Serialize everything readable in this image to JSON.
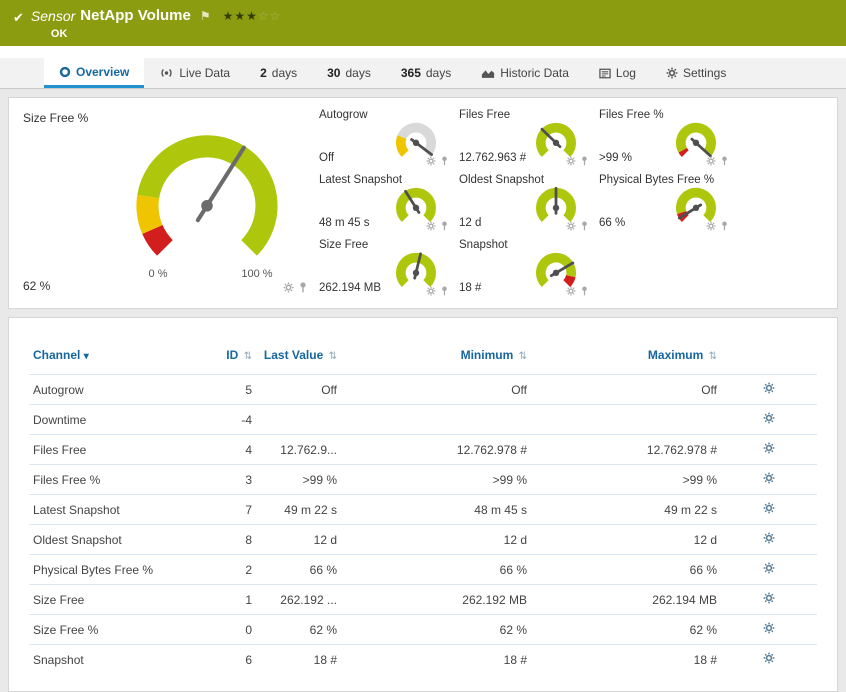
{
  "header": {
    "kind": "Sensor",
    "title": "NetApp Volume",
    "status": "OK",
    "stars_filled": 3,
    "stars_total": 5
  },
  "tabs": [
    {
      "label": "Overview",
      "icon": "overview-icon",
      "active": true
    },
    {
      "label": "Live Data",
      "icon": "live-data-icon",
      "active": false
    },
    {
      "bold": "2",
      "label": "days",
      "active": false
    },
    {
      "bold": "30",
      "label": "days",
      "active": false
    },
    {
      "bold": "365",
      "label": "days",
      "active": false
    },
    {
      "label": "Historic Data",
      "icon": "historic-data-icon",
      "active": false
    },
    {
      "label": "Log",
      "icon": "log-icon",
      "active": false
    },
    {
      "label": "Settings",
      "icon": "settings-icon",
      "active": false
    }
  ],
  "primary_gauge": {
    "label": "Size Free %",
    "value": "62 %",
    "min_label": "0 %",
    "max_label": "100 %",
    "needle": 0.62,
    "segments": [
      {
        "from": 0,
        "to": 0.08,
        "color": "#d21e1c"
      },
      {
        "from": 0.08,
        "to": 0.2,
        "color": "#eec500"
      },
      {
        "from": 0.2,
        "to": 1,
        "color": "#aec70c"
      }
    ]
  },
  "mini_gauges": [
    {
      "label": "Autogrow",
      "value": "Off",
      "needle": 0.97,
      "segments": [
        {
          "from": 0,
          "to": 0.25,
          "color": "#eec500"
        },
        {
          "from": 0.25,
          "to": 1,
          "color": "#d9d9d9"
        }
      ]
    },
    {
      "label": "Files Free",
      "value": "12.762.963 #",
      "needle": 0.33,
      "segments": [
        {
          "from": 0,
          "to": 1,
          "color": "#aec70c"
        }
      ]
    },
    {
      "label": "Files Free %",
      "value": ">99 %",
      "needle": 0.99,
      "segments": [
        {
          "from": 0,
          "to": 0.06,
          "color": "#d21e1c"
        },
        {
          "from": 0.06,
          "to": 1,
          "color": "#aec70c"
        }
      ]
    },
    {
      "label": "Latest Snapshot",
      "value": "48 m 45 s",
      "needle": 0.38,
      "segments": [
        {
          "from": 0,
          "to": 1,
          "color": "#aec70c"
        }
      ]
    },
    {
      "label": "Oldest Snapshot",
      "value": "12 d",
      "needle": 0.5,
      "segments": [
        {
          "from": 0,
          "to": 1,
          "color": "#aec70c"
        }
      ]
    },
    {
      "label": "Physical Bytes Free %",
      "value": "66 %",
      "needle": 0.05,
      "segments": [
        {
          "from": 0,
          "to": 0.1,
          "color": "#d21e1c"
        },
        {
          "from": 0.1,
          "to": 1,
          "color": "#aec70c"
        }
      ]
    },
    {
      "label": "Size Free",
      "value": "262.194 MB",
      "needle": 0.55,
      "segments": [
        {
          "from": 0,
          "to": 1,
          "color": "#aec70c"
        }
      ]
    },
    {
      "label": "Snapshot",
      "value": "18 #",
      "needle": 0.72,
      "segments": [
        {
          "from": 0,
          "to": 0.88,
          "color": "#aec70c"
        },
        {
          "from": 0.88,
          "to": 1,
          "color": "#d21e1c"
        }
      ]
    }
  ],
  "table": {
    "columns": [
      {
        "label": "Channel",
        "sort": "menu"
      },
      {
        "label": "ID",
        "sort": "both"
      },
      {
        "label": "Last Value",
        "sort": "both"
      },
      {
        "label": "Minimum",
        "sort": "both"
      },
      {
        "label": "Maximum",
        "sort": "both"
      },
      {
        "label": "",
        "sort": ""
      }
    ],
    "rows": [
      {
        "channel": "Autogrow",
        "id": "5",
        "last": "Off",
        "min": "Off",
        "max": "Off"
      },
      {
        "channel": "Downtime",
        "id": "-4",
        "last": "",
        "min": "",
        "max": ""
      },
      {
        "channel": "Files Free",
        "id": "4",
        "last": "12.762.9...",
        "min": "12.762.978 #",
        "max": "12.762.978 #"
      },
      {
        "channel": "Files Free %",
        "id": "3",
        "last": ">99 %",
        "min": ">99 %",
        "max": ">99 %"
      },
      {
        "channel": "Latest Snapshot",
        "id": "7",
        "last": "49 m 22 s",
        "min": "48 m 45 s",
        "max": "49 m 22 s"
      },
      {
        "channel": "Oldest Snapshot",
        "id": "8",
        "last": "12 d",
        "min": "12 d",
        "max": "12 d"
      },
      {
        "channel": "Physical Bytes Free %",
        "id": "2",
        "last": "66 %",
        "min": "66 %",
        "max": "66 %"
      },
      {
        "channel": "Size Free",
        "id": "1",
        "last": "262.192 ...",
        "min": "262.192 MB",
        "max": "262.194 MB"
      },
      {
        "channel": "Size Free %",
        "id": "0",
        "last": "62 %",
        "min": "62 %",
        "max": "62 %"
      },
      {
        "channel": "Snapshot",
        "id": "6",
        "last": "18 #",
        "min": "18 #",
        "max": "18 #"
      }
    ]
  },
  "colors": {
    "status_ok": "#8b9c10",
    "gauge_green": "#aec70c",
    "gauge_yellow": "#eec500",
    "gauge_red": "#d21e1c",
    "tab_active": "#2191cf",
    "table_header_text": "#1667a0"
  }
}
